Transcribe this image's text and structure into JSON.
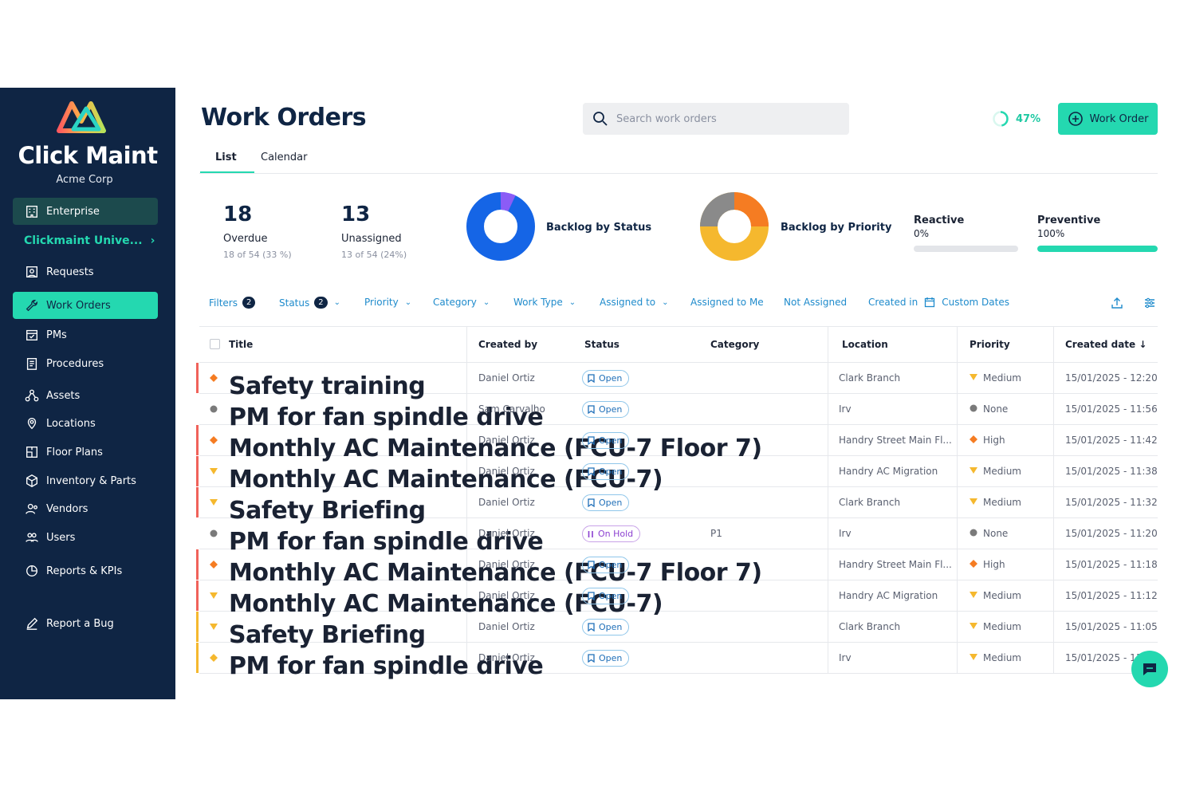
{
  "app": {
    "brand": "Click Maint",
    "company": "Acme Corp"
  },
  "sidebar": {
    "items": [
      {
        "label": "Enterprise",
        "icon": "building-icon"
      },
      {
        "label": "Clickmaint Unive...",
        "icon": "chevron-right-icon"
      },
      {
        "label": "Requests",
        "icon": "requests-icon"
      },
      {
        "label": "Work Orders",
        "icon": "wrench-icon"
      },
      {
        "label": "PMs",
        "icon": "calendar-check-icon"
      },
      {
        "label": "Procedures",
        "icon": "clipboard-icon"
      },
      {
        "label": "Assets",
        "icon": "assets-icon"
      },
      {
        "label": "Locations",
        "icon": "location-pin-icon"
      },
      {
        "label": "Floor Plans",
        "icon": "floor-plan-icon"
      },
      {
        "label": "Inventory & Parts",
        "icon": "box-icon"
      },
      {
        "label": "Vendors",
        "icon": "vendors-icon"
      },
      {
        "label": "Users",
        "icon": "users-icon"
      },
      {
        "label": "Reports & KPIs",
        "icon": "pie-chart-icon"
      },
      {
        "label": "Report a Bug",
        "icon": "pencil-icon"
      }
    ]
  },
  "header": {
    "title": "Work Orders",
    "search_placeholder": "Search work orders",
    "progress_label": "47%",
    "progress_value": 0.47,
    "new_button": "Work Order"
  },
  "tabs": [
    "List",
    "Calendar"
  ],
  "stats": {
    "overdue": {
      "value": "18",
      "label": "Overdue",
      "sub": "18 of 54 (33 %)"
    },
    "unassigned": {
      "value": "13",
      "label": "Unassigned",
      "sub": "13 of 54 (24%)"
    },
    "backlog_status_label": "Backlog by Status",
    "backlog_priority_label": "Backlog by Priority",
    "reactive": {
      "label": "Reactive",
      "value": "0%",
      "fraction": 0
    },
    "preventive": {
      "label": "Preventive",
      "value": "100%",
      "fraction": 1
    }
  },
  "colors": {
    "accent": "#24d8b0",
    "navy": "#0f2544",
    "status_blue": "#1f6fb8",
    "donut_blue": "#1565e6",
    "donut_purple": "#8b5cf6",
    "orange": "#f57c22",
    "yellow": "#f5b82e",
    "gray": "#7a7a7a"
  },
  "filters": {
    "filters": "Filters",
    "filters_count": "2",
    "status": "Status",
    "status_count": "2",
    "priority": "Priority",
    "category": "Category",
    "work_type": "Work Type",
    "assigned_to": "Assigned to",
    "assigned_to_me": "Assigned to Me",
    "not_assigned": "Not Assigned",
    "created_in": "Created in",
    "custom_dates": "Custom Dates"
  },
  "table": {
    "columns": [
      "Title",
      "Created by",
      "Status",
      "Category",
      "Location",
      "Priority",
      "Created date"
    ],
    "rows": [
      {
        "title": "Safety training",
        "created_by": "Daniel Ortiz",
        "status": "Open",
        "category": "",
        "location": "Clark Branch",
        "priority": "Medium",
        "date": "15/01/2025 - 12:20",
        "mark": "orange",
        "ticon": "high"
      },
      {
        "title": "PM for fan spindle drive",
        "created_by": "Sam Carvalho",
        "status": "Open",
        "category": "",
        "location": "Irv",
        "priority": "None",
        "date": "15/01/2025 - 11:56",
        "mark": "",
        "ticon": "none"
      },
      {
        "title": "Monthly AC Maintenance (FCU-7 Floor 7)",
        "created_by": "Daniel Ortiz",
        "status": "Open",
        "category": "",
        "location": "Handry Street Main Fl...",
        "priority": "High",
        "date": "15/01/2025 - 11:42",
        "mark": "orange",
        "ticon": "high"
      },
      {
        "title": "Monthly AC Maintenance (FCU-7)",
        "created_by": "Daniel Ortiz",
        "status": "Open",
        "category": "",
        "location": "Handry AC Migration",
        "priority": "Medium",
        "date": "15/01/2025 - 11:38",
        "mark": "orange",
        "ticon": "medium"
      },
      {
        "title": "Safety Briefing",
        "created_by": "Daniel Ortiz",
        "status": "Open",
        "category": "",
        "location": "Clark Branch",
        "priority": "Medium",
        "date": "15/01/2025 - 11:32",
        "mark": "orange",
        "ticon": "medium"
      },
      {
        "title": "PM for fan spindle drive",
        "created_by": "Daniel Ortiz",
        "status": "On Hold",
        "category": "P1",
        "location": "Irv",
        "priority": "None",
        "date": "15/01/2025 - 11:20",
        "mark": "",
        "ticon": "none"
      },
      {
        "title": "Monthly AC Maintenance (FCU-7 Floor 7)",
        "created_by": "Daniel Ortiz",
        "status": "Open",
        "category": "",
        "location": "Handry Street Main Fl...",
        "priority": "High",
        "date": "15/01/2025 - 11:18",
        "mark": "orange",
        "ticon": "high"
      },
      {
        "title": "Monthly AC Maintenance (FCU-7)",
        "created_by": "Daniel Ortiz",
        "status": "Open",
        "category": "",
        "location": "Handry AC Migration",
        "priority": "Medium",
        "date": "15/01/2025 - 11:12",
        "mark": "orange",
        "ticon": "medium"
      },
      {
        "title": "Safety Briefing",
        "created_by": "Daniel Ortiz",
        "status": "Open",
        "category": "",
        "location": "Clark Branch",
        "priority": "Medium",
        "date": "15/01/2025 - 11:05",
        "mark": "yellow",
        "ticon": "medium"
      },
      {
        "title": "PM for fan spindle drive",
        "created_by": "Daniel Ortiz",
        "status": "Open",
        "category": "",
        "location": "Irv",
        "priority": "Medium",
        "date": "15/01/2025 - 11",
        "mark": "yellow",
        "ticon": "high-yellow"
      }
    ]
  }
}
